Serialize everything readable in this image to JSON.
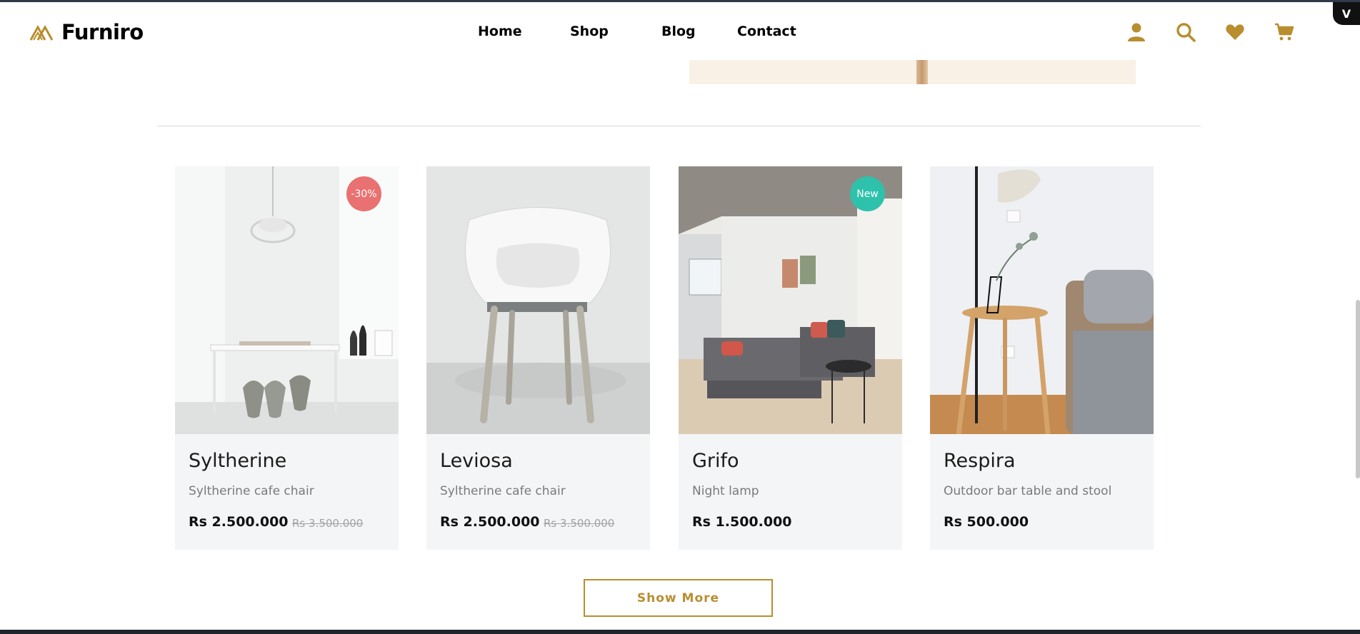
{
  "brand": {
    "name": "Furniro"
  },
  "nav": {
    "home": "Home",
    "shop": "Shop",
    "blog": "Blog",
    "contact": "Contact"
  },
  "header_icons": [
    "user-icon",
    "search-icon",
    "heart-icon",
    "cart-icon"
  ],
  "accent_color": "#b88e2f",
  "products": [
    {
      "name": "Syltherine",
      "desc": "Syltherine cafe chair",
      "price": "Rs 2.500.000",
      "old_price": "Rs 3.500.000",
      "badge": "-30%",
      "badge_color": "#e97171"
    },
    {
      "name": "Leviosa",
      "desc": "Syltherine cafe chair",
      "price": "Rs 2.500.000",
      "old_price": "Rs 3.500.000"
    },
    {
      "name": "Grifo",
      "desc": "Night lamp",
      "price": "Rs 1.500.000",
      "badge": "New",
      "badge_color": "#2ec1ac"
    },
    {
      "name": "Respira",
      "desc": "Outdoor bar table and stool",
      "price": "Rs 500.000"
    }
  ],
  "show_more": "Show More"
}
